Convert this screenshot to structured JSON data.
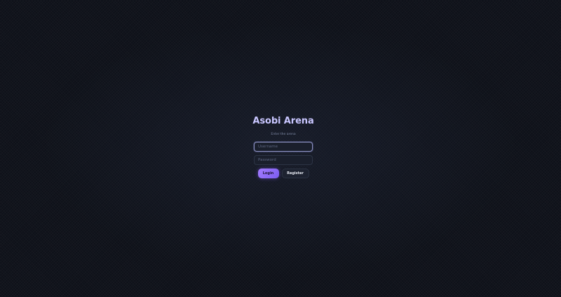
{
  "app": {
    "title": "Asobi Arena",
    "subtitle": "Enter the arena"
  },
  "form": {
    "username": {
      "value": "",
      "placeholder": "Username"
    },
    "password": {
      "value": "",
      "placeholder": "Password"
    },
    "login_label": "Login",
    "register_label": "Register"
  },
  "colors": {
    "background": "#0e1119",
    "title": "#c9c6ff",
    "accent": "#8b6cf6"
  }
}
